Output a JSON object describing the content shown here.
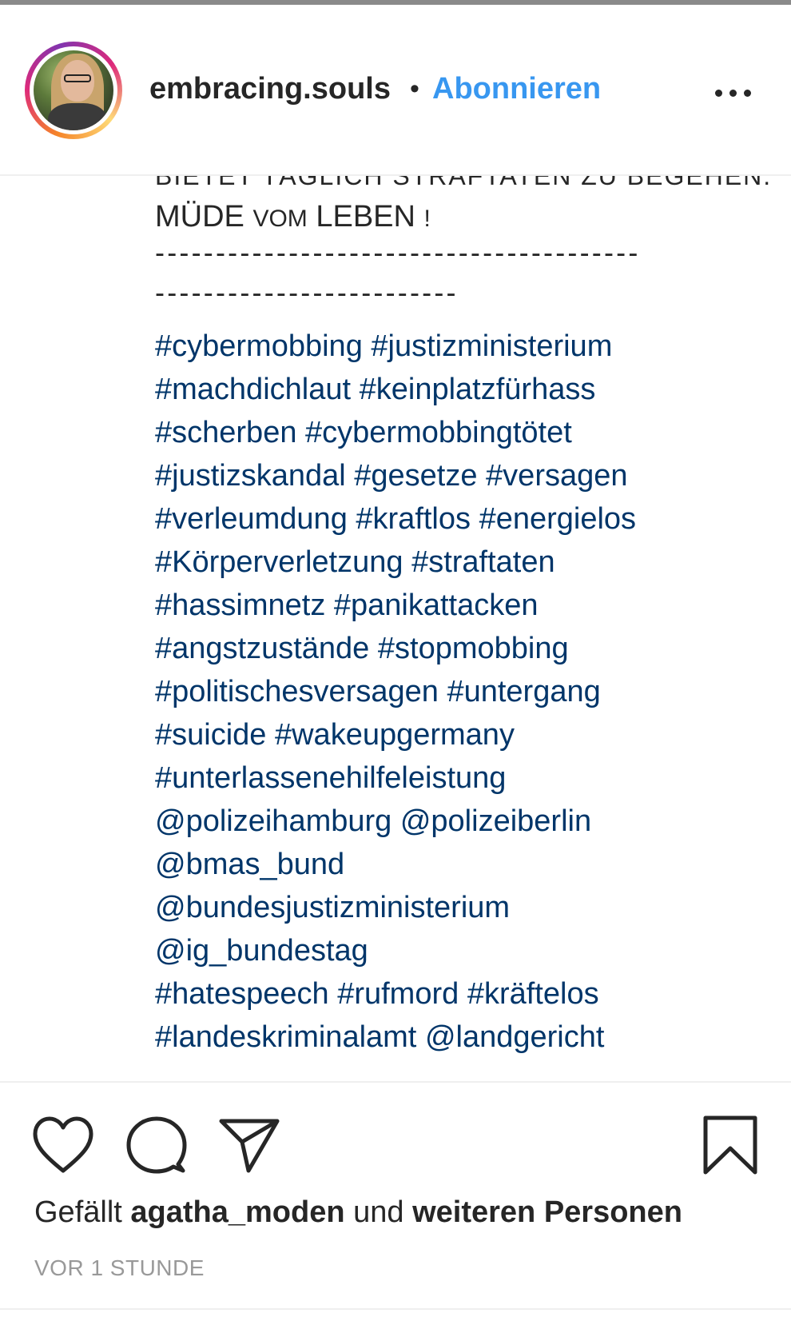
{
  "header": {
    "username": "embracing.souls",
    "separator": "•",
    "follow_label": "Abonnieren",
    "more_icon": "more-horizontal-icon"
  },
  "caption": {
    "cut_line": "BIETET TÄGLICH STRAFTATEN ZU BEGEHEN.",
    "tired_line": {
      "part1": "MÜDE ",
      "part2": "VOM",
      "part3": " LEBEN ",
      "part4": "!"
    },
    "dash_line_1": "----------------------------------------",
    "dash_line_2": "-------------------------",
    "tag_lines": [
      [
        "#cybermobbing",
        "#justizministerium"
      ],
      [
        "#machdichlaut",
        "#keinplatzfürhass"
      ],
      [
        "#scherben",
        "#cybermobbingtötet"
      ],
      [
        "#justizskandal",
        "#gesetze",
        "#versagen"
      ],
      [
        "#verleumdung",
        "#kraftlos",
        "#energielos"
      ],
      [
        "#Körperverletzung",
        "#straftaten"
      ],
      [
        "#hassimnetz",
        "#panikattacken"
      ],
      [
        "#angstzustände",
        "#stopmobbing"
      ],
      [
        "#politischesversagen",
        "#untergang"
      ],
      [
        "#suicide",
        "#wakeupgermany"
      ],
      [
        "#unterlassenehilfeleistung"
      ],
      [
        "@polizeihamburg",
        "@polizeiberlin"
      ],
      [
        "@bmas_bund"
      ],
      [
        "@bundesjustizministerium"
      ],
      [
        "@ig_bundestag"
      ],
      [
        "#hatespeech",
        "#rufmord",
        "#kräftelos"
      ],
      [
        "#landeskriminalamt",
        "@landgericht"
      ]
    ]
  },
  "actions": {
    "like_icon": "heart-icon",
    "comment_icon": "comment-icon",
    "share_icon": "send-icon",
    "save_icon": "bookmark-icon"
  },
  "likes": {
    "prefix": "Gefällt ",
    "user": "agatha_moden",
    "middle": " und ",
    "others": "weiteren Personen"
  },
  "timestamp": "VOR 1 STUNDE",
  "colors": {
    "link": "#003569",
    "follow": "#3897f0",
    "text": "#262626",
    "muted": "#999999"
  }
}
